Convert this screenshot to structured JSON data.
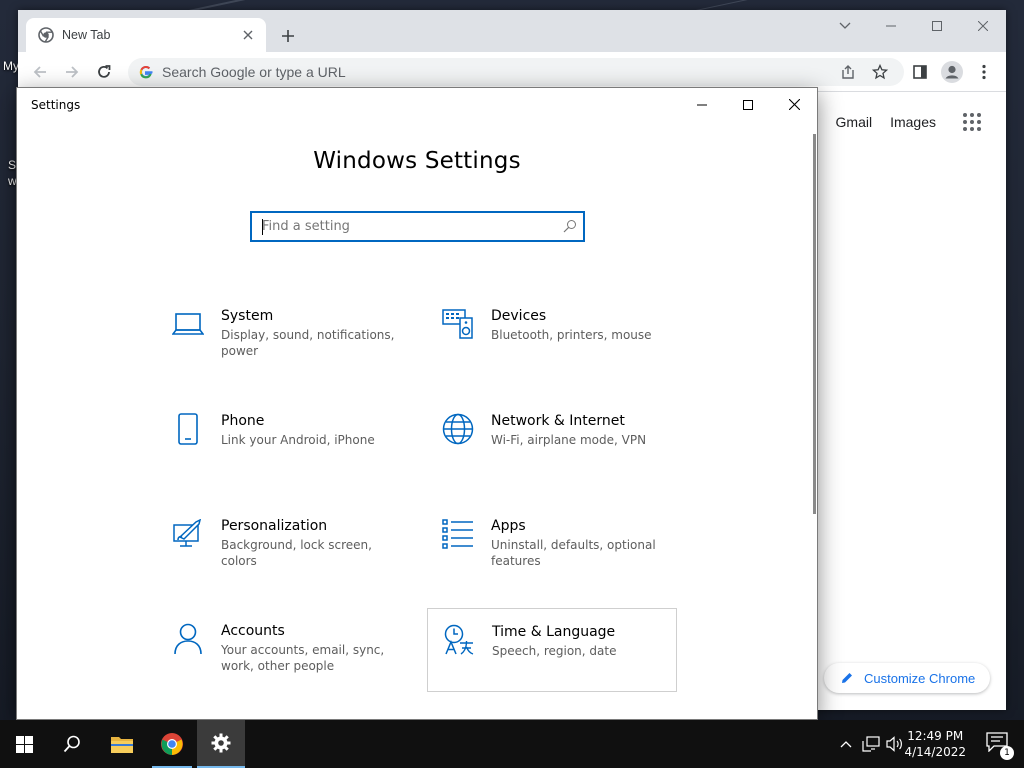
{
  "desktop": {
    "label_1": "My",
    "label_2": "S",
    "label_3": "w"
  },
  "chrome": {
    "tab_title": "New Tab",
    "omnibox_placeholder": "Search Google or type a URL",
    "links": {
      "gmail": "Gmail",
      "images": "Images"
    },
    "customize_label": "Customize Chrome"
  },
  "settings": {
    "window_title": "Settings",
    "heading": "Windows Settings",
    "search_placeholder": "Find a setting",
    "accent": "#0067c0",
    "categories": [
      {
        "title": "System",
        "desc": "Display, sound, notifications, power",
        "icon": "laptop-icon"
      },
      {
        "title": "Devices",
        "desc": "Bluetooth, printers, mouse",
        "icon": "keyboard-speaker-icon"
      },
      {
        "title": "Phone",
        "desc": "Link your Android, iPhone",
        "icon": "phone-icon"
      },
      {
        "title": "Network & Internet",
        "desc": "Wi-Fi, airplane mode, VPN",
        "icon": "globe-icon"
      },
      {
        "title": "Personalization",
        "desc": "Background, lock screen, colors",
        "icon": "paintbrush-icon"
      },
      {
        "title": "Apps",
        "desc": "Uninstall, defaults, optional features",
        "icon": "apps-list-icon"
      },
      {
        "title": "Accounts",
        "desc": "Your accounts, email, sync, work, other people",
        "icon": "person-icon"
      },
      {
        "title": "Time & Language",
        "desc": "Speech, region, date",
        "icon": "time-language-icon"
      }
    ]
  },
  "taskbar": {
    "time": "12:49 PM",
    "date": "4/14/2022",
    "notification_count": "1"
  }
}
